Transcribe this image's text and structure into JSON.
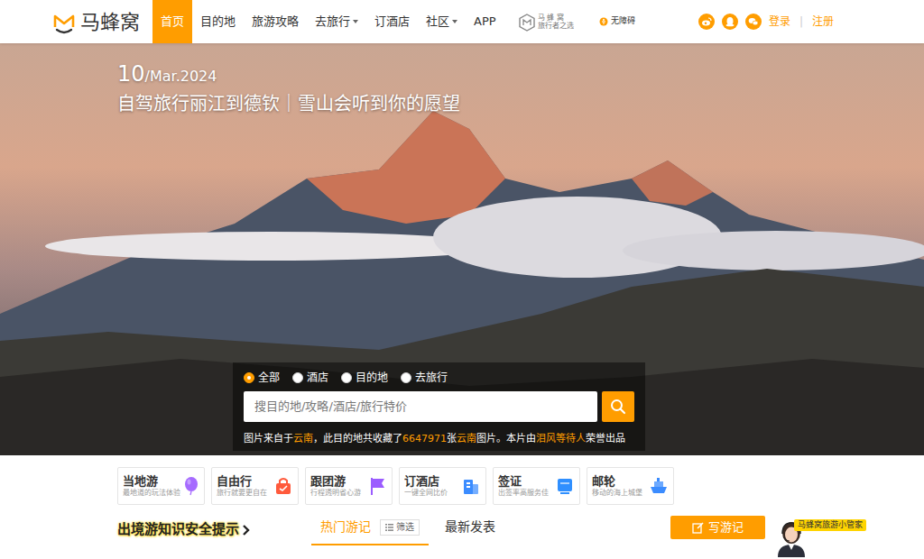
{
  "nav": {
    "logo": "马蜂窝",
    "items": [
      {
        "label": "首页",
        "selected": true,
        "dropdown": false
      },
      {
        "label": "目的地",
        "selected": false,
        "dropdown": false
      },
      {
        "label": "旅游攻略",
        "selected": false,
        "dropdown": false
      },
      {
        "label": "去旅行",
        "selected": false,
        "dropdown": true
      },
      {
        "label": "订酒店",
        "selected": false,
        "dropdown": false
      },
      {
        "label": "社区",
        "selected": false,
        "dropdown": true
      },
      {
        "label": "APP",
        "selected": false,
        "dropdown": false
      }
    ],
    "brand": {
      "name": "马 蜂 窝",
      "subtitle": "旅行者之选"
    },
    "accessibility": "无障碍",
    "login": "登录",
    "separator": "|",
    "register": "注册"
  },
  "hero": {
    "day": "10",
    "month_year": "/Mar.2024",
    "title": "自驾旅行丽江到德钦｜雪山会听到你的愿望",
    "search": {
      "options": [
        {
          "label": "全部",
          "selected": true
        },
        {
          "label": "酒店",
          "selected": false
        },
        {
          "label": "目的地",
          "selected": false
        },
        {
          "label": "去旅行",
          "selected": false
        }
      ],
      "placeholder": "搜目的地/攻略/酒店/旅行特价"
    },
    "caption": [
      {
        "text": "图片来自于",
        "highlight": false
      },
      {
        "text": "云南",
        "highlight": true
      },
      {
        "text": "，此目的地共收藏了",
        "highlight": false
      },
      {
        "text": "6647971",
        "highlight": true
      },
      {
        "text": "张",
        "highlight": false
      },
      {
        "text": "云南",
        "highlight": true
      },
      {
        "text": "图片。本片由",
        "highlight": false
      },
      {
        "text": "泪风等待人",
        "highlight": true
      },
      {
        "text": "荣誉出品",
        "highlight": false
      }
    ]
  },
  "services": [
    {
      "title": "当地游",
      "desc": "最地道的玩法体验",
      "color": "#a66bff"
    },
    {
      "title": "自由行",
      "desc": "旅行就要更自在",
      "color": "#ff5a3c"
    },
    {
      "title": "跟团游",
      "desc": "行程透明省心游",
      "color": "#9b5cff"
    },
    {
      "title": "订酒店",
      "desc": "一键全网比价",
      "color": "#3b8cff"
    },
    {
      "title": "签证",
      "desc": "出签率高服务佳",
      "color": "#2f8fff"
    },
    {
      "title": "邮轮",
      "desc": "移动的海上城堡",
      "color": "#3b8cff"
    }
  ],
  "bottom": {
    "notice": "出境游知识安全提示",
    "tabs": [
      {
        "label": "热门游记",
        "selected": true
      },
      {
        "label": "最新发表",
        "selected": false
      }
    ],
    "filter": "筛选",
    "write": "写游记",
    "assistant": "马蜂窝旅游小管家"
  }
}
